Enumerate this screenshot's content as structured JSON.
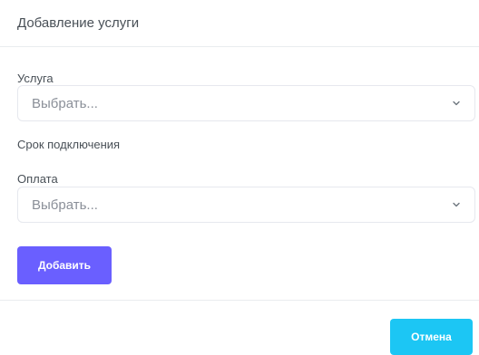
{
  "modal": {
    "title": "Добавление услуги"
  },
  "form": {
    "service_label": "Услуга",
    "service_select_value": "Выбрать...",
    "connection_term_label": "Срок подключения",
    "payment_label": "Оплата",
    "payment_select_value": "Выбрать...",
    "add_button_label": "Добавить"
  },
  "footer": {
    "cancel_button_label": "Отмена"
  },
  "icons": {
    "select_chevron": "chevron-down-icon"
  },
  "colors": {
    "primary": "#6a5fff",
    "info": "#1cc6f4"
  }
}
